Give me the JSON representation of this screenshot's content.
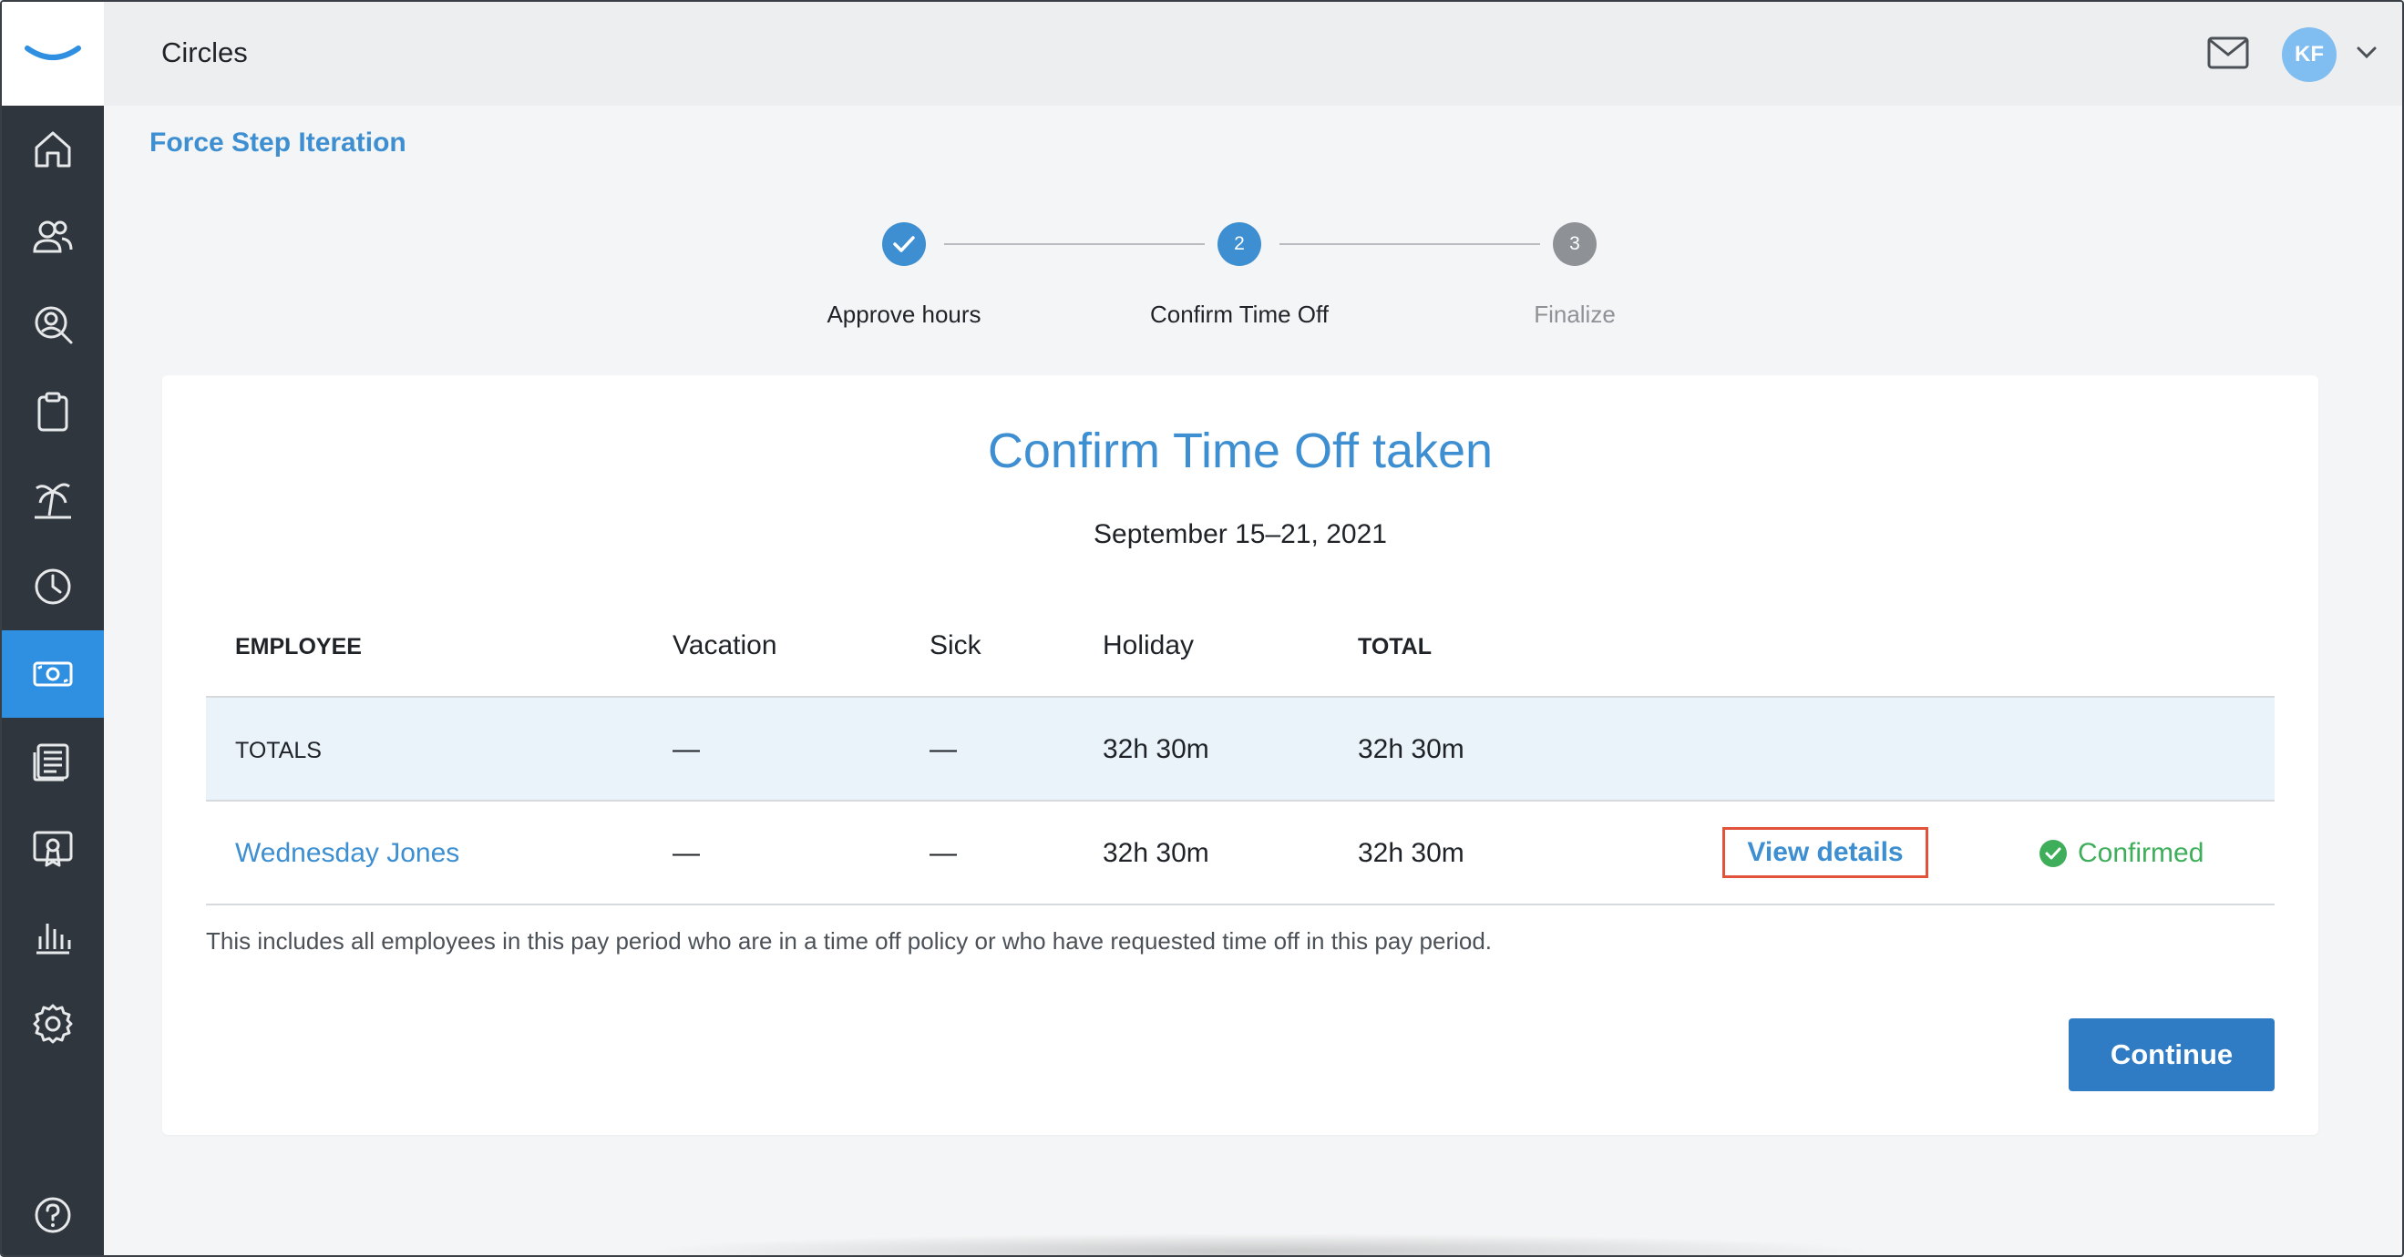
{
  "app": {
    "title": "Circles"
  },
  "header": {
    "user_initials": "KF"
  },
  "sidebar": {
    "items": [
      {
        "name": "home",
        "icon": "home-icon",
        "active": false
      },
      {
        "name": "people",
        "icon": "people-icon",
        "active": false
      },
      {
        "name": "search-person",
        "icon": "person-search-icon",
        "active": false
      },
      {
        "name": "clipboard",
        "icon": "clipboard-icon",
        "active": false
      },
      {
        "name": "time-off",
        "icon": "palm-tree-icon",
        "active": false
      },
      {
        "name": "time",
        "icon": "clock-icon",
        "active": false
      },
      {
        "name": "payroll",
        "icon": "money-icon",
        "active": true
      },
      {
        "name": "reports-docs",
        "icon": "newspaper-icon",
        "active": false
      },
      {
        "name": "training",
        "icon": "certificate-icon",
        "active": false
      },
      {
        "name": "analytics",
        "icon": "bar-chart-icon",
        "active": false
      },
      {
        "name": "settings",
        "icon": "gear-icon",
        "active": false
      },
      {
        "name": "help",
        "icon": "help-icon",
        "active": false
      }
    ]
  },
  "breadcrumb": "Force Step Iteration",
  "stepper": {
    "steps": [
      {
        "label": "Approve hours",
        "number": "1",
        "state": "done"
      },
      {
        "label": "Confirm Time Off",
        "number": "2",
        "state": "current"
      },
      {
        "label": "Finalize",
        "number": "3",
        "state": "upcoming"
      }
    ]
  },
  "card": {
    "title": "Confirm Time Off taken",
    "date_range": "September 15–21, 2021",
    "table": {
      "headers": {
        "employee": "EMPLOYEE",
        "vacation": "Vacation",
        "sick": "Sick",
        "holiday": "Holiday",
        "total": "TOTAL"
      },
      "totals_row": {
        "label": "TOTALS",
        "vacation": "—",
        "sick": "—",
        "holiday": "32h 30m",
        "total": "32h 30m"
      },
      "rows": [
        {
          "employee": "Wednesday Jones",
          "vacation": "—",
          "sick": "—",
          "holiday": "32h 30m",
          "total": "32h 30m",
          "action": "View details",
          "status": "Confirmed"
        }
      ]
    },
    "note": "This includes all employees in this pay period who are in a time off policy or who have requested time off in this pay period.",
    "continue_label": "Continue"
  },
  "colors": {
    "accent": "#3d8fd1",
    "sidebar_bg": "#2f363d",
    "active_nav": "#2f8fe0",
    "success": "#3fae5a",
    "highlight_border": "#e0533a",
    "button": "#2f7bc4"
  }
}
